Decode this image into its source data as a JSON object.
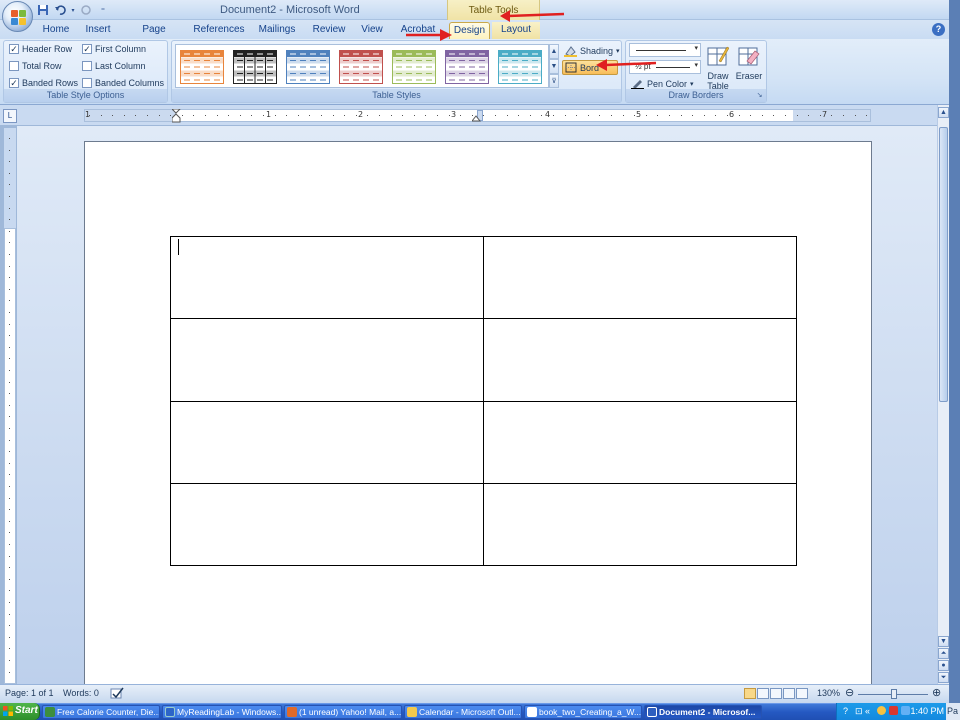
{
  "app": {
    "doc_title": "Document2 - Microsoft Word",
    "contextual_header": "Table Tools"
  },
  "tabs": [
    "Home",
    "Insert",
    "Page Layout",
    "References",
    "Mailings",
    "Review",
    "View",
    "Acrobat",
    "Design",
    "Layout"
  ],
  "active_tab": "Design",
  "ribbon": {
    "table_style_options": {
      "label": "Table Style Options",
      "checkboxes": [
        {
          "label": "Header Row",
          "checked": true
        },
        {
          "label": "First Column",
          "checked": true
        },
        {
          "label": "Total Row",
          "checked": false
        },
        {
          "label": "Last Column",
          "checked": false
        },
        {
          "label": "Banded Rows",
          "checked": true
        },
        {
          "label": "Banded Columns",
          "checked": false
        }
      ]
    },
    "table_styles": {
      "label": "Table Styles",
      "shading": "Shading",
      "borders": "Bord",
      "style_colors": [
        "#e8843b",
        "#222222",
        "#4f81bd",
        "#c0504d",
        "#9bbb59",
        "#8064a2",
        "#4bacc6"
      ]
    },
    "draw_borders": {
      "label": "Draw Borders",
      "pen_weight": "½ pt",
      "pen_color": "Pen Color",
      "draw_table": "Draw Table",
      "eraser": "Eraser"
    }
  },
  "ruler_numbers": [
    "1",
    "1",
    "2",
    "3",
    "4",
    "5",
    "6",
    "7"
  ],
  "document": {
    "table": {
      "rows": 4,
      "cols": 2
    }
  },
  "status": {
    "page": "Page: 1 of 1",
    "words": "Words: 0",
    "zoom": "130%"
  },
  "taskbar": {
    "start": "Start",
    "items": [
      "Free Calorie Counter, Die...",
      "MyReadingLab - Windows...",
      "(1 unread) Yahoo! Mail, a...",
      "Calendar - Microsoft Outl...",
      "book_two_Creating_a_W...",
      "Document2 - Microsof..."
    ],
    "clock": "1:40 PM"
  },
  "right_edge_text": "Pa"
}
